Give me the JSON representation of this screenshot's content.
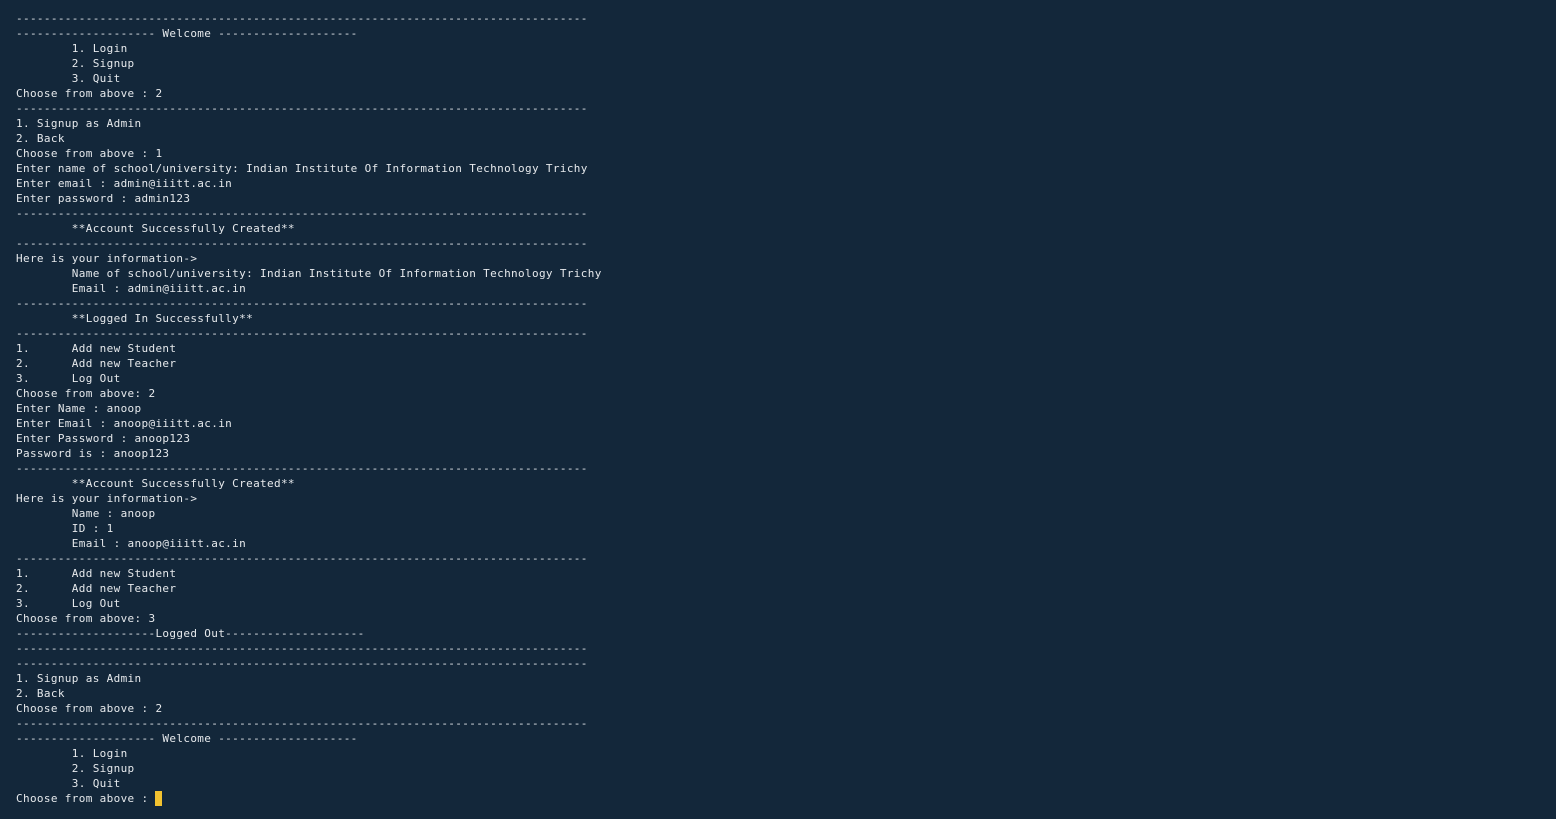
{
  "terminal": {
    "lines": [
      "----------------------------------------------------------------------------------",
      "-------------------- Welcome --------------------",
      "        1. Login",
      "        2. Signup",
      "        3. Quit",
      "Choose from above : 2",
      "----------------------------------------------------------------------------------",
      "1. Signup as Admin",
      "2. Back",
      "Choose from above : 1",
      "Enter name of school/university: Indian Institute Of Information Technology Trichy",
      "Enter email : admin@iiitt.ac.in",
      "Enter password : admin123",
      "----------------------------------------------------------------------------------",
      "        **Account Successfully Created**",
      "----------------------------------------------------------------------------------",
      "Here is your information->",
      "        Name of school/university: Indian Institute Of Information Technology Trichy",
      "        Email : admin@iiitt.ac.in",
      "----------------------------------------------------------------------------------",
      "        **Logged In Successfully**",
      "----------------------------------------------------------------------------------",
      "1.      Add new Student",
      "2.      Add new Teacher",
      "3.      Log Out",
      "Choose from above: 2",
      "Enter Name : anoop",
      "Enter Email : anoop@iiitt.ac.in",
      "Enter Password : anoop123",
      "Password is : anoop123",
      "----------------------------------------------------------------------------------",
      "        **Account Successfully Created**",
      "Here is your information->",
      "        Name : anoop",
      "        ID : 1",
      "        Email : anoop@iiitt.ac.in",
      "----------------------------------------------------------------------------------",
      "1.      Add new Student",
      "2.      Add new Teacher",
      "3.      Log Out",
      "Choose from above: 3",
      "--------------------Logged Out--------------------",
      "----------------------------------------------------------------------------------",
      "----------------------------------------------------------------------------------",
      "1. Signup as Admin",
      "2. Back",
      "Choose from above : 2",
      "----------------------------------------------------------------------------------",
      "-------------------- Welcome --------------------",
      "        1. Login",
      "        2. Signup",
      "        3. Quit"
    ],
    "prompt": "Choose from above : "
  },
  "colors": {
    "background": "#13273a",
    "text": "#e6e9ec",
    "cursor": "#f2c230"
  }
}
